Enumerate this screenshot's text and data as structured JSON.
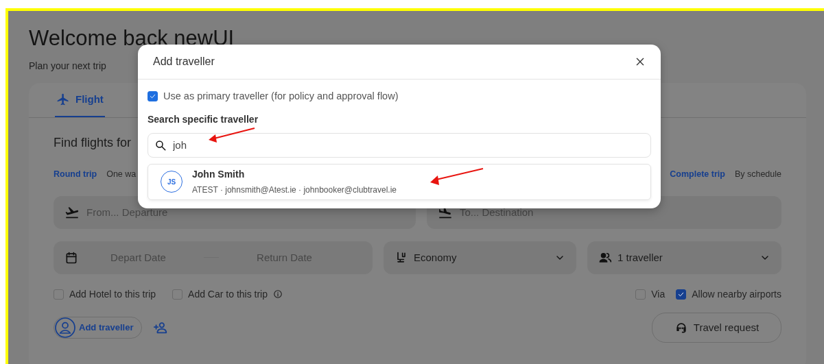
{
  "page": {
    "title": "Welcome back newUI",
    "subtitle": "Plan your next trip"
  },
  "search_card": {
    "tabs": [
      {
        "label": "Flight",
        "selected": true
      }
    ],
    "heading": "Find flights for",
    "trip_types": [
      {
        "label": "Round trip",
        "selected": true
      },
      {
        "label": "One wa",
        "selected": false
      }
    ],
    "journey_modes": [
      {
        "label": "Complete trip",
        "selected": true
      },
      {
        "label": "By schedule",
        "selected": false
      }
    ],
    "from": {
      "placeholder": "From... Departure"
    },
    "to": {
      "placeholder": "To... Destination"
    },
    "depart_date": {
      "placeholder": "Depart Date"
    },
    "return_date": {
      "placeholder": "Return Date"
    },
    "cabin_class": "Economy",
    "travellers": "1 traveller",
    "extras": [
      {
        "label": "Add Hotel to this trip",
        "checked": false
      },
      {
        "label": "Add Car to this trip",
        "checked": false
      }
    ],
    "flight_options": [
      {
        "label": "Via",
        "checked": false
      },
      {
        "label": "Allow nearby airports",
        "checked": true
      }
    ],
    "add_traveller_button": "Add traveller",
    "travel_request_button": "Travel request"
  },
  "modal": {
    "title": "Add traveller",
    "primary_traveller": {
      "label": "Use as primary traveller (for policy and approval flow)",
      "checked": true
    },
    "search_label": "Search specific traveller",
    "search_value": "joh",
    "results": [
      {
        "initials": "JS",
        "name": "John Smith",
        "details": "ATEST · johnsmith@Atest.ie · johnbooker@clubtravel.ie"
      }
    ]
  }
}
